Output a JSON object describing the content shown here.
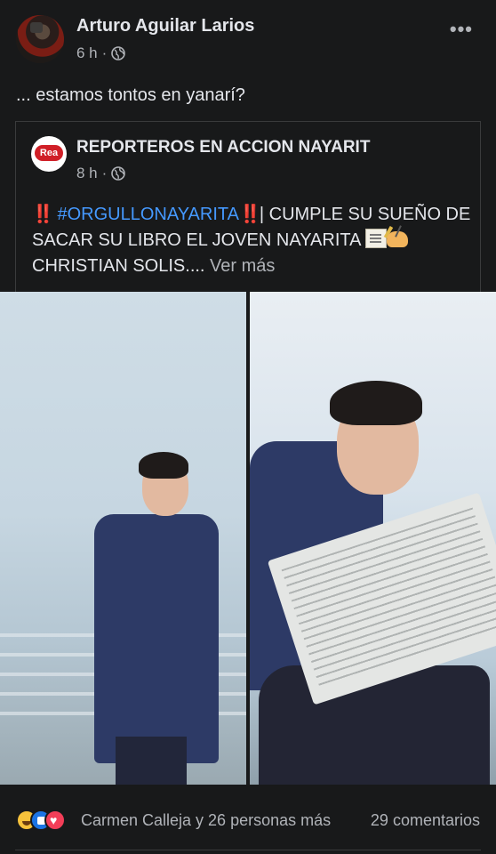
{
  "post": {
    "author": "Arturo Aguilar Larios",
    "time": "6 h",
    "separator": "·",
    "more": "•••",
    "text": "... estamos tontos en yanarí?"
  },
  "shared": {
    "page_name": "REPORTEROS EN ACCION NAYARIT",
    "page_logo_text": "Rea",
    "time": "8 h",
    "separator": "·",
    "text_bangs": "‼️",
    "hashtag": "#ORGULLONAYARITA",
    "text_part1": "| CUMPLE SU SUEÑO DE SACAR SU LIBRO EL JOVEN NAYARITA",
    "text_part2": "CHRISTIAN SOLIS....",
    "see_more": "Ver más"
  },
  "photos": {
    "left_icon": "photo-man-coat-standing",
    "right_icon": "photo-man-reading-newspaper"
  },
  "reactions": {
    "icons": [
      "haha-icon",
      "like-icon",
      "love-icon"
    ],
    "summary": "Carmen Calleja y 26 personas más",
    "comments": "29 comentarios"
  },
  "colors": {
    "background": "#18191a",
    "text": "#e4e6eb",
    "secondary_text": "#b0b3b8",
    "hashtag": "#4599ff",
    "bang": "#e0332f"
  }
}
